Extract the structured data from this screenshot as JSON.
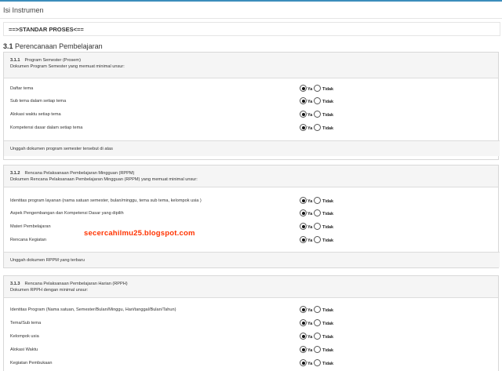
{
  "header": {
    "title": "Isi Instrumen"
  },
  "standard": {
    "label": "==>STANDAR PROSES<=="
  },
  "section": {
    "number": "3.1",
    "title": "Perencanaan Pembelajaran"
  },
  "option_labels": {
    "yes": "Ya",
    "no": "Tidak"
  },
  "panels": [
    {
      "number": "3.1.1",
      "title": "Program Semester (Prosem)",
      "subtitle": "Dokumen Program Semester yang memuat minimal unsur:",
      "items": [
        {
          "label": "Daftar tema",
          "selected": "Ya"
        },
        {
          "label": "Sub tema dalam setiap tema",
          "selected": "Ya"
        },
        {
          "label": "Alokasi waktu setiap tema",
          "selected": "Ya"
        },
        {
          "label": "Kompetensi dasar dalam setiap tema",
          "selected": "Ya"
        }
      ],
      "footer": "Unggah dokumen program semester tersebut di atas"
    },
    {
      "number": "3.1.2",
      "title": "Rencana Pelaksanaan Pembelajaran Mingguan (RPPM)",
      "subtitle": "Dokumen Rencana Pelaksanaan Pembelajaran Mingguan (RPPM) yang memuat minimal unsur:",
      "items": [
        {
          "label": "Identitas program layanan (nama satuan semester, bulan/minggu, tema sub tema, kelompok usia )",
          "selected": "Ya"
        },
        {
          "label": "Aspek Pengembangan dan Kompetensi Dasar yang dipilih",
          "selected": "Ya"
        },
        {
          "label": "Materi Pembelajaran",
          "selected": "Ya"
        },
        {
          "label": "Rencana Kegiatan",
          "selected": "Ya"
        }
      ],
      "footer": "Unggah dokumen RPPM yang terbaru"
    },
    {
      "number": "3.1.3",
      "title": "Rencana Pelaksanaan Pembelajaran Harian (RPPH)",
      "subtitle": "Dokumen RPPH dengan minimal unsur:",
      "items": [
        {
          "label": "Identitas Program (Nama satuan, Semester/Bulan/Minggu, Hari/tanggal/Bulan/Tahun)",
          "selected": "Ya"
        },
        {
          "label": "Tema/Sub tema",
          "selected": "Ya"
        },
        {
          "label": "Kelompok usia",
          "selected": "Ya"
        },
        {
          "label": "Alokasi Waktu",
          "selected": "Ya"
        },
        {
          "label": "Kegiatan Pembukaan",
          "selected": "Ya"
        }
      ]
    }
  ],
  "watermark": {
    "text": "secercahilmu25.blogspot.com",
    "color": "#ff3300"
  },
  "colors": {
    "accent": "#3c8dbc",
    "panel_header": "#f5f5f5"
  }
}
